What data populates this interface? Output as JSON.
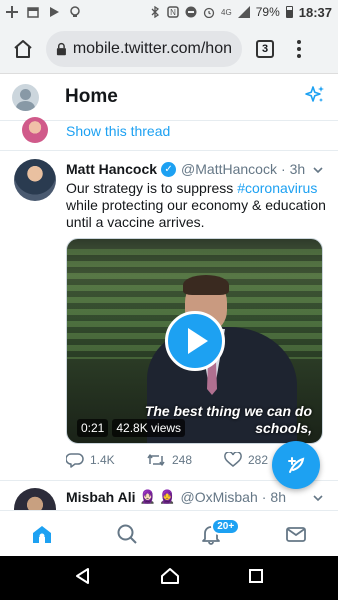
{
  "statusbar": {
    "battery": "79%",
    "time": "18:37",
    "signal": "4G"
  },
  "browser": {
    "url": "mobile.twitter.com/hon",
    "tab_count": "3"
  },
  "header": {
    "title": "Home"
  },
  "thread_row": {
    "link": "Show this thread"
  },
  "tweet": {
    "name": "Matt Hancock",
    "handle": "@MattHancock",
    "separator": "·",
    "time": "3h",
    "text_before": "Our strategy is to suppress ",
    "hashtag": "#coronavirus",
    "text_after": " while protecting our economy & education until a vaccine arrives.",
    "video": {
      "caption": "The best thing we can do schools,",
      "duration": "0:21",
      "views": "42.8K views"
    },
    "reply_count": "1.4K",
    "retweet_count": "248",
    "like_count": "282"
  },
  "tweet2": {
    "name": "Misbah Ali",
    "emojis": "🧕🏻 🧕",
    "handle": "@OxMisbah",
    "separator": "·",
    "time": "8h"
  },
  "bottomnav": {
    "notifications_badge": "20+"
  },
  "colors": {
    "accent": "#1da1f2",
    "text": "#14171a",
    "muted": "#657786"
  }
}
